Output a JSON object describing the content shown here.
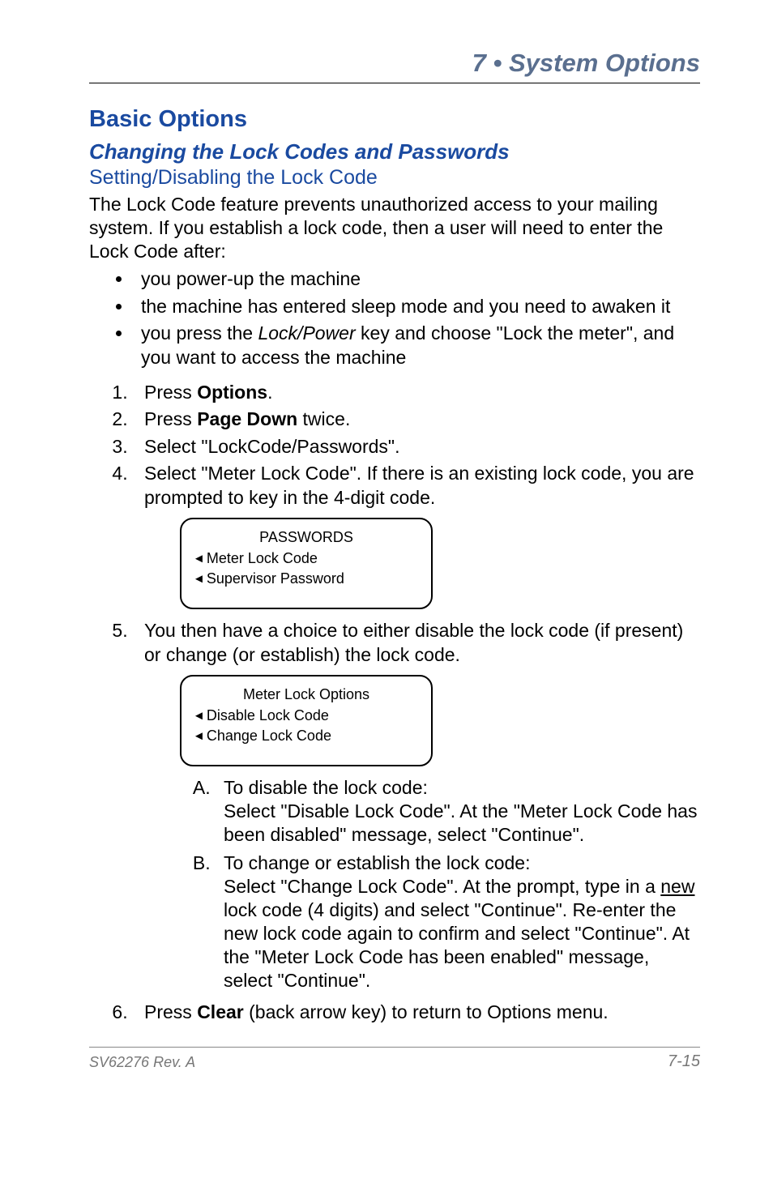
{
  "chapter_header": "7 • System Options",
  "h1": "Basic Options",
  "h2": "Changing the Lock Codes and Passwords",
  "h3": "Setting/Disabling the Lock Code",
  "intro": "The Lock Code feature prevents unauthorized access to your mailing system. If you establish a lock code, then a user will need to enter the Lock Code after:",
  "bullets": {
    "b1": "you power-up the machine",
    "b2": "the machine has entered sleep mode and you need to awaken it",
    "b3_pre": "you press the ",
    "b3_italic": "Lock/Power",
    "b3_post": " key and choose \"Lock the meter\", and you want to access the machine"
  },
  "steps": {
    "s1_pre": "Press ",
    "s1_bold": "Options",
    "s1_post": ".",
    "s2_pre": "Press ",
    "s2_bold": "Page Down",
    "s2_post": " twice.",
    "s3": "Select \"LockCode/Passwords\".",
    "s4": "Select \"Meter Lock Code\". If there is an existing lock code, you are prompted to key in the 4-digit code.",
    "s5": "You then have a choice to either disable the lock code (if present) or change (or establish) the lock code.",
    "s6_pre": "Press ",
    "s6_bold": "Clear",
    "s6_post": " (back arrow key) to return to Options menu."
  },
  "screen1": {
    "title": "PASSWORDS",
    "row1": "Meter Lock Code",
    "row2": "Supervisor Password"
  },
  "screen2": {
    "title": "Meter Lock Options",
    "row1": "Disable Lock Code",
    "row2": "Change Lock Code"
  },
  "sub": {
    "a_title": "To disable the lock code:",
    "a_body": "Select \"Disable Lock Code\". At the \"Meter Lock Code has been disabled\" message, select \"Continue\".",
    "b_title": "To change or establish the lock code:",
    "b_body_pre": "Select \"Change Lock Code\". At the prompt, type in a ",
    "b_body_u": "new",
    "b_body_post": " lock code (4 digits) and select \"Continue\". Re-enter the new lock code again to confirm and select \"Continue\". At the \"Meter Lock Code has been enabled\" message, select \"Continue\"."
  },
  "footer_left": "SV62276 Rev. A",
  "footer_right": "7-15"
}
